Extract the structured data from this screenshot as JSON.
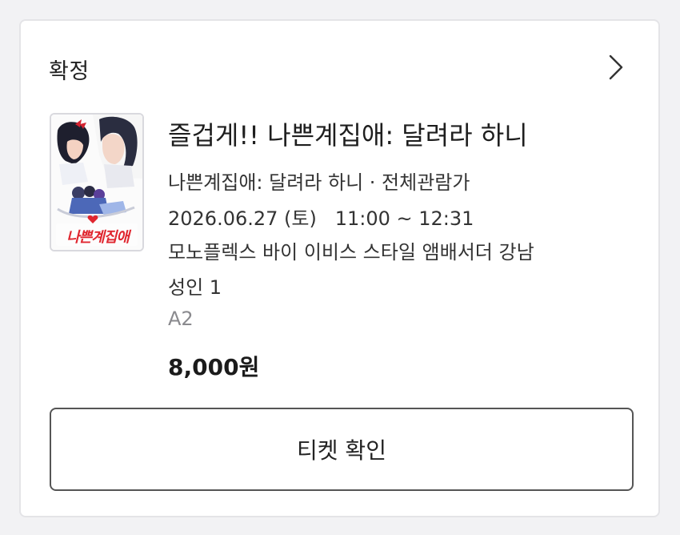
{
  "booking": {
    "status": "확정",
    "movie_title": "즐겁게!! 나쁜계집애: 달려라 하니",
    "subtitle_line": "나쁜계집애: 달려라 하니 · 전체관람가",
    "datetime": "2026.06.27 (토)   11:00 ~ 12:31",
    "theater": "모노플렉스 바이 이비스 스타일 앰배서더 강남",
    "audience": "성인 1",
    "seat": "A2",
    "price": "8,000원",
    "ticket_button_label": "티켓 확인",
    "poster_logo_text": "나쁜계집애"
  },
  "colors": {
    "card_border": "#e4e4e7",
    "button_border": "#555555",
    "seat_text": "#8a8a8e",
    "poster_logo_red": "#e0262f"
  },
  "icons": {
    "detail": "chevron-right-icon"
  }
}
